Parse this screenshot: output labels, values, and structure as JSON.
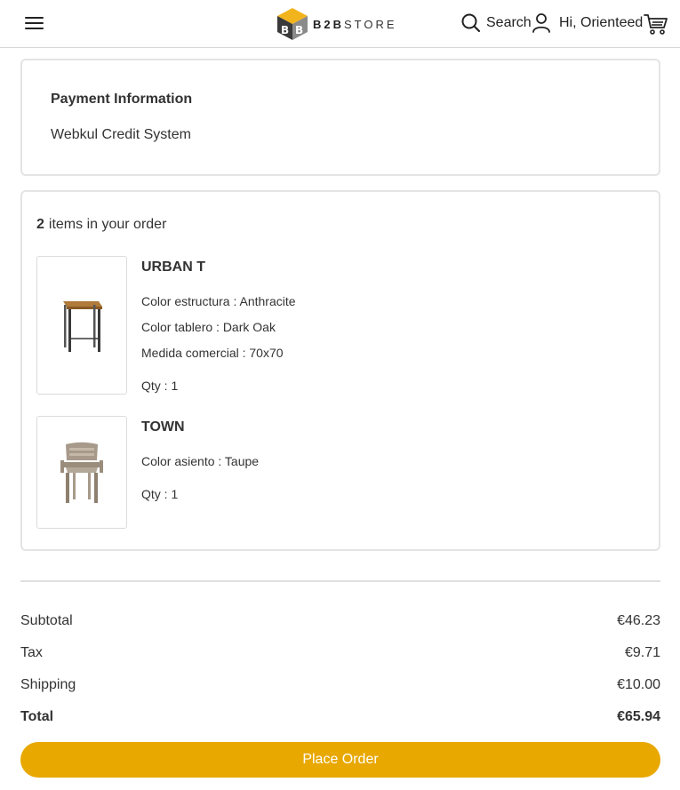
{
  "header": {
    "menu_icon": "hamburger-menu-icon",
    "logo": {
      "strong": "B2B",
      "rest": "STORE"
    },
    "search_label": "Search",
    "search_icon": "search-icon",
    "user_label": "Hi, Orienteed",
    "user_icon": "user-icon",
    "cart_icon": "cart-icon"
  },
  "payment": {
    "title": "Payment Information",
    "method": "Webkul Credit System"
  },
  "order_items": {
    "count": "2",
    "heading_suffix": "items in your order",
    "items": [
      {
        "name": "URBAN T",
        "image_icon": "bar-table-product-image",
        "attributes": [
          "Color estructura : Anthracite",
          "Color tablero : Dark Oak",
          "Medida comercial : 70x70"
        ],
        "qty": "Qty : 1"
      },
      {
        "name": "TOWN",
        "image_icon": "armchair-product-image",
        "attributes": [
          "Color asiento : Taupe"
        ],
        "qty": "Qty : 1"
      }
    ]
  },
  "summary": {
    "rows": [
      {
        "label": "Subtotal",
        "value": "€46.23"
      },
      {
        "label": "Tax",
        "value": "€9.71"
      },
      {
        "label": "Shipping",
        "value": "€10.00"
      },
      {
        "label": "Total",
        "value": "€65.94"
      }
    ]
  },
  "place_order_label": "Place Order",
  "colors": {
    "accent": "#e8a800",
    "border": "#e4e4e4",
    "text": "#333333"
  }
}
